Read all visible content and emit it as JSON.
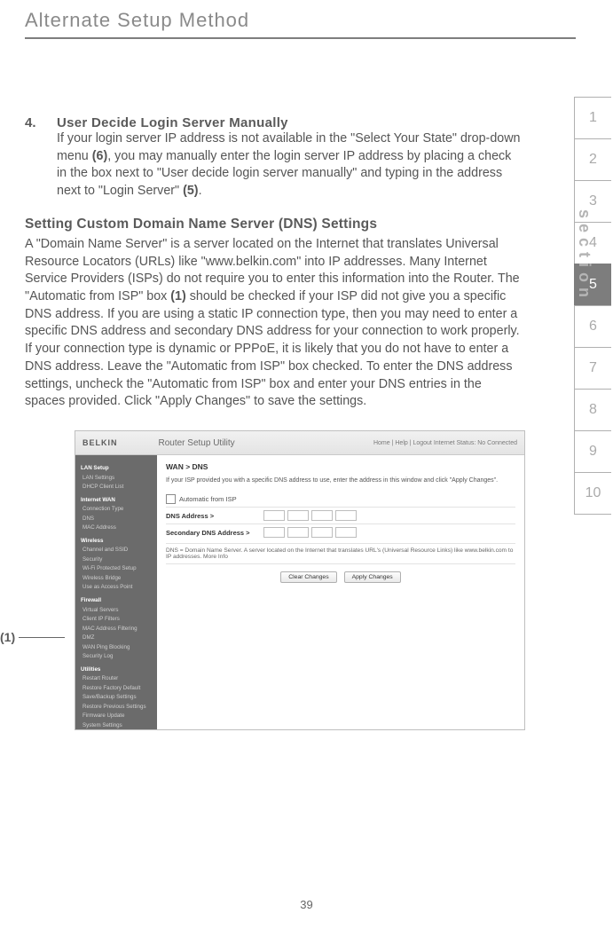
{
  "page": {
    "header_title": "Alternate Setup Method",
    "page_number": "39"
  },
  "section_nav": {
    "label": "section",
    "items": [
      "1",
      "2",
      "3",
      "4",
      "5",
      "6",
      "7",
      "8",
      "9",
      "10"
    ],
    "active_index": 4
  },
  "step": {
    "number": "4.",
    "title": "User Decide Login Server Manually",
    "body_pre": "If your login server IP address is not available in the \"Select Your State\" drop-down menu ",
    "ref1": "(6)",
    "body_mid": ", you may manually enter the login server IP address by placing a check in the box next to \"User decide login server manually\" and typing in the address next to \"Login Server\" ",
    "ref2": "(5)",
    "body_post": "."
  },
  "dns": {
    "heading": "Setting Custom Domain Name Server (DNS) Settings",
    "body_pre": "A \"Domain Name Server\" is a server located on the Internet that translates Universal Resource Locators (URLs) like \"www.belkin.com\" into IP addresses. Many Internet Service Providers (ISPs) do not require you to enter this information into the Router. The \"Automatic from ISP\" box ",
    "ref": "(1)",
    "body_post": " should be checked if your ISP did not give you a specific DNS address. If you are using a static IP connection type, then you may need to enter a specific DNS address and secondary DNS address for your connection to work properly. If your connection type is dynamic or PPPoE, it is likely that you do not have to enter a DNS address. Leave the \"Automatic from ISP\" box checked. To enter the DNS address settings, uncheck the \"Automatic from ISP\" box and enter your DNS entries in the spaces provided. Click \"Apply Changes\" to save the settings."
  },
  "callout": {
    "ref": "(1)"
  },
  "screenshot": {
    "brand": "BELKIN",
    "title": "Router Setup Utility",
    "right": "Home | Help | Logout   Internet Status: No Connected",
    "sidebar": {
      "groups": [
        {
          "title": "LAN Setup",
          "items": [
            "LAN Settings",
            "DHCP Client List"
          ]
        },
        {
          "title": "Internet WAN",
          "items": [
            "Connection Type",
            "DNS",
            "MAC Address"
          ]
        },
        {
          "title": "Wireless",
          "items": [
            "Channel and SSID",
            "Security",
            "Wi-Fi Protected Setup",
            "Wireless Bridge",
            "Use as Access Point"
          ]
        },
        {
          "title": "Firewall",
          "items": [
            "Virtual Servers",
            "Client IP Filters",
            "MAC Address Filtering",
            "DMZ",
            "WAN Ping Blocking",
            "Security Log"
          ]
        },
        {
          "title": "Utilities",
          "items": [
            "Restart Router",
            "Restore Factory Default",
            "Save/Backup Settings",
            "Restore Previous Settings",
            "Firmware Update",
            "System Settings"
          ]
        }
      ]
    },
    "main": {
      "crumbs": "WAN > DNS",
      "info": "If your ISP provided you with a specific DNS address to use, enter the address in this window and click \"Apply Changes\".",
      "auto_label": "Automatic from ISP",
      "dns_label": "DNS Address >",
      "sec_label": "Secondary DNS Address >",
      "note": "DNS = Domain Name Server. A server located on the Internet that translates URL's (Universal Resource Links) like www.belkin.com to IP addresses. More Info",
      "btn_clear": "Clear Changes",
      "btn_apply": "Apply Changes"
    }
  }
}
